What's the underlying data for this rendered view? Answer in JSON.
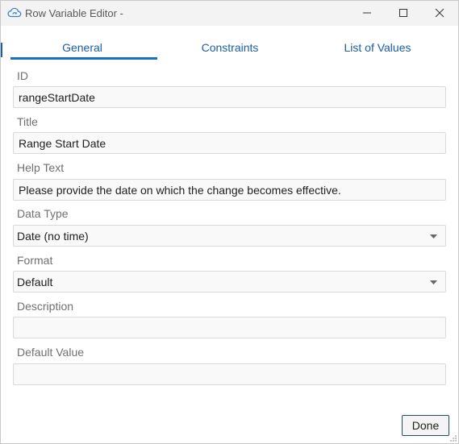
{
  "window": {
    "title": "Row Variable Editor -",
    "app_icon": "cloud-refresh-icon",
    "controls": [
      "minimize-icon",
      "maximize-icon",
      "close-icon"
    ]
  },
  "tabs": [
    {
      "label": "General",
      "selected": true
    },
    {
      "label": "Constraints",
      "selected": false
    },
    {
      "label": "List of Values",
      "selected": false
    }
  ],
  "form": {
    "id": {
      "label": "ID",
      "value": "rangeStartDate"
    },
    "title": {
      "label": "Title",
      "value": "Range Start Date"
    },
    "help_text": {
      "label": "Help Text",
      "value": "Please provide the date on which the change becomes effective."
    },
    "data_type": {
      "label": "Data Type",
      "value": "Date (no time)"
    },
    "format": {
      "label": "Format",
      "value": "Default"
    },
    "description": {
      "label": "Description",
      "value": ""
    },
    "default_value": {
      "label": "Default Value",
      "value": ""
    }
  },
  "footer": {
    "done_label": "Done"
  },
  "colors": {
    "accent": "#1a6fc2",
    "tab_text": "#1a5ea8",
    "label_text": "#707070"
  }
}
